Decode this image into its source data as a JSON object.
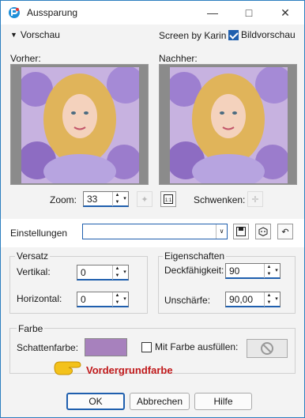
{
  "window": {
    "title": "Aussparung"
  },
  "preview": {
    "toggle_label": "Vorschau",
    "credit": "Screen by Karin",
    "bildvorschau_label": "Bildvorschau",
    "bildvorschau_checked": true,
    "before_label": "Vorher:",
    "after_label": "Nachher:",
    "zoom_label": "Zoom:",
    "zoom_value": "33",
    "pan_label": "Schwenken:"
  },
  "settings": {
    "label": "Einstellungen",
    "preset_value": ""
  },
  "versatz": {
    "title": "Versatz",
    "vertical_label": "Vertikal:",
    "vertical_value": "0",
    "horizontal_label": "Horizontal:",
    "horizontal_value": "0"
  },
  "eigenschaften": {
    "title": "Eigenschaften",
    "opacity_label": "Deckfähigkeit:",
    "opacity_value": "90",
    "blur_label": "Unschärfe:",
    "blur_value": "90,00"
  },
  "farbe": {
    "title": "Farbe",
    "shadow_label": "Schattenfarbe:",
    "shadow_color": "#a781bd",
    "fill_label": "Mit Farbe ausfüllen:",
    "fill_checked": false
  },
  "annotation": "Vordergrundfarbe",
  "buttons": {
    "ok": "OK",
    "cancel": "Abbrechen",
    "help": "Hilfe"
  },
  "colors": {
    "accent": "#1f5fae",
    "annotation": "#c0181a"
  }
}
